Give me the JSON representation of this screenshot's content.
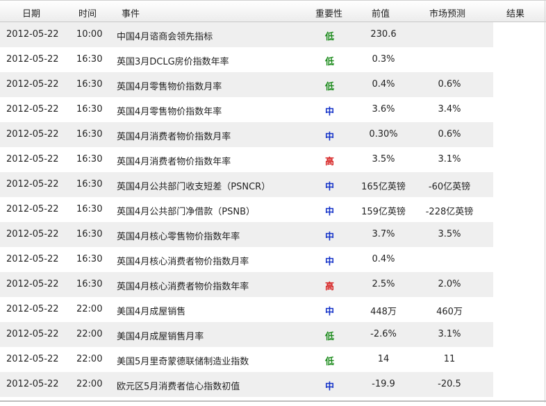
{
  "headers": {
    "date": "日期",
    "time": "时间",
    "event": "事件",
    "importance": "重要性",
    "previous": "前值",
    "forecast": "市场预测",
    "result": "结果"
  },
  "importance_colors": {
    "低": "#1a8a1a",
    "中": "#1130c8",
    "高": "#d62020"
  },
  "rows": [
    {
      "date": "2012-05-22",
      "time": "10:00",
      "event": "中国4月谘商会领先指标",
      "importance": "低",
      "previous": "230.6",
      "forecast": "",
      "result": ""
    },
    {
      "date": "2012-05-22",
      "time": "16:30",
      "event": "英国3月DCLG房价指数年率",
      "importance": "低",
      "previous": "0.3%",
      "forecast": "",
      "result": ""
    },
    {
      "date": "2012-05-22",
      "time": "16:30",
      "event": "英国4月零售物价指数月率",
      "importance": "低",
      "previous": "0.4%",
      "forecast": "0.6%",
      "result": ""
    },
    {
      "date": "2012-05-22",
      "time": "16:30",
      "event": "英国4月零售物价指数年率",
      "importance": "中",
      "previous": "3.6%",
      "forecast": "3.4%",
      "result": ""
    },
    {
      "date": "2012-05-22",
      "time": "16:30",
      "event": "英国4月消费者物价指数月率",
      "importance": "中",
      "previous": "0.30%",
      "forecast": "0.6%",
      "result": ""
    },
    {
      "date": "2012-05-22",
      "time": "16:30",
      "event": "英国4月消费者物价指数年率",
      "importance": "高",
      "previous": "3.5%",
      "forecast": "3.1%",
      "result": ""
    },
    {
      "date": "2012-05-22",
      "time": "16:30",
      "event": "英国4月公共部门收支短差（PSNCR）",
      "importance": "中",
      "previous": "165亿英镑",
      "forecast": "-60亿英镑",
      "result": ""
    },
    {
      "date": "2012-05-22",
      "time": "16:30",
      "event": "英国4月公共部门净借款（PSNB）",
      "importance": "中",
      "previous": "159亿英镑",
      "forecast": "-228亿英镑",
      "result": ""
    },
    {
      "date": "2012-05-22",
      "time": "16:30",
      "event": "英国4月核心零售物价指数年率",
      "importance": "中",
      "previous": "3.7%",
      "forecast": "3.5%",
      "result": ""
    },
    {
      "date": "2012-05-22",
      "time": "16:30",
      "event": "英国4月核心消费者物价指数月率",
      "importance": "中",
      "previous": "0.4%",
      "forecast": "",
      "result": ""
    },
    {
      "date": "2012-05-22",
      "time": "16:30",
      "event": "英国4月核心消费者物价指数年率",
      "importance": "高",
      "previous": "2.5%",
      "forecast": "2.0%",
      "result": ""
    },
    {
      "date": "2012-05-22",
      "time": "22:00",
      "event": "美国4月成屋销售",
      "importance": "中",
      "previous": "448万",
      "forecast": "460万",
      "result": ""
    },
    {
      "date": "2012-05-22",
      "time": "22:00",
      "event": "美国4月成屋销售月率",
      "importance": "低",
      "previous": "-2.6%",
      "forecast": "3.1%",
      "result": ""
    },
    {
      "date": "2012-05-22",
      "time": "22:00",
      "event": "美国5月里奇蒙德联储制造业指数",
      "importance": "低",
      "previous": "14",
      "forecast": "11",
      "result": ""
    },
    {
      "date": "2012-05-22",
      "time": "22:00",
      "event": "欧元区5月消费者信心指数初值",
      "importance": "中",
      "previous": "-19.9",
      "forecast": "-20.5",
      "result": ""
    }
  ]
}
